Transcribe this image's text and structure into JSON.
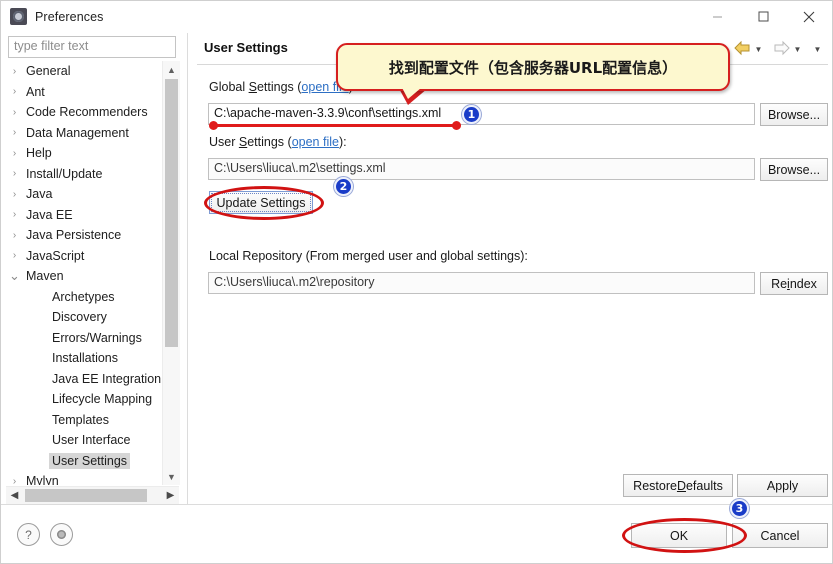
{
  "window": {
    "title": "Preferences",
    "icon": "preferences-icon",
    "controls": {
      "minimize": "minimize-icon",
      "maximize": "maximize-icon",
      "close": "close-icon"
    }
  },
  "sidebar": {
    "filter": {
      "placeholder": "type filter text",
      "value": ""
    },
    "items": [
      {
        "label": "General",
        "expander": "collapsed",
        "level": 0,
        "selected": false
      },
      {
        "label": "Ant",
        "expander": "collapsed",
        "level": 0,
        "selected": false
      },
      {
        "label": "Code Recommenders",
        "expander": "collapsed",
        "level": 0,
        "selected": false
      },
      {
        "label": "Data Management",
        "expander": "collapsed",
        "level": 0,
        "selected": false
      },
      {
        "label": "Help",
        "expander": "collapsed",
        "level": 0,
        "selected": false
      },
      {
        "label": "Install/Update",
        "expander": "collapsed",
        "level": 0,
        "selected": false
      },
      {
        "label": "Java",
        "expander": "collapsed",
        "level": 0,
        "selected": false
      },
      {
        "label": "Java EE",
        "expander": "collapsed",
        "level": 0,
        "selected": false
      },
      {
        "label": "Java Persistence",
        "expander": "collapsed",
        "level": 0,
        "selected": false
      },
      {
        "label": "JavaScript",
        "expander": "collapsed",
        "level": 0,
        "selected": false
      },
      {
        "label": "Maven",
        "expander": "expanded",
        "level": 0,
        "selected": false
      },
      {
        "label": "Archetypes",
        "expander": "none",
        "level": 1,
        "selected": false
      },
      {
        "label": "Discovery",
        "expander": "none",
        "level": 1,
        "selected": false
      },
      {
        "label": "Errors/Warnings",
        "expander": "none",
        "level": 1,
        "selected": false
      },
      {
        "label": "Installations",
        "expander": "none",
        "level": 1,
        "selected": false
      },
      {
        "label": "Java EE Integration",
        "expander": "none",
        "level": 1,
        "selected": false
      },
      {
        "label": "Lifecycle Mapping",
        "expander": "none",
        "level": 1,
        "selected": false
      },
      {
        "label": "Templates",
        "expander": "none",
        "level": 1,
        "selected": false
      },
      {
        "label": "User Interface",
        "expander": "none",
        "level": 1,
        "selected": false
      },
      {
        "label": "User Settings",
        "expander": "none",
        "level": 1,
        "selected": true
      },
      {
        "label": "Mylyn",
        "expander": "collapsed",
        "level": 0,
        "selected": false
      }
    ]
  },
  "page": {
    "title": "User Settings",
    "nav": {
      "back": "back-arrow-icon",
      "back_menu": "chevron-down-icon",
      "forward": "forward-arrow-icon",
      "forward_menu": "chevron-down-icon",
      "view_menu": "chevron-down-icon"
    },
    "global_settings": {
      "label_prefix": "Global ",
      "label_mnemonic": "S",
      "label_rest": "ettings (",
      "link": "open file",
      "label_suffix": "):",
      "value": "C:\\apache-maven-3.3.9\\conf\\settings.xml",
      "browse": "Browse..."
    },
    "user_settings": {
      "label_prefix": "User ",
      "label_mnemonic": "S",
      "label_rest": "ettings (",
      "link": "open file",
      "label_suffix": "):",
      "value": "C:\\Users\\liuca\\.m2\\settings.xml",
      "browse": "Browse..."
    },
    "update_settings_button": "Update Settings",
    "local_repository": {
      "label": "Local Repository (From merged user and global settings):",
      "value": "C:\\Users\\liuca\\.m2\\repository",
      "reindex_prefix": "Re",
      "reindex_mnemonic": "i",
      "reindex_rest": "ndex"
    },
    "restore_defaults": {
      "prefix": "Restore ",
      "mnemonic": "D",
      "rest": "efaults"
    },
    "apply": "Apply"
  },
  "footer": {
    "help_icon": "help-icon",
    "settings_icon": "gear-icon",
    "ok": "OK",
    "cancel": "Cancel"
  },
  "annotations": {
    "callout_text": "找到配置文件（包含服务器URL配置信息）",
    "badges": [
      "1",
      "2",
      "3"
    ],
    "colors": {
      "callout_fill": "#FDF8CF",
      "callout_border": "#D61F1F",
      "marker_red": "#D11212",
      "badge_blue": "#1A3CC8",
      "link_blue": "#2D6FC4"
    }
  }
}
